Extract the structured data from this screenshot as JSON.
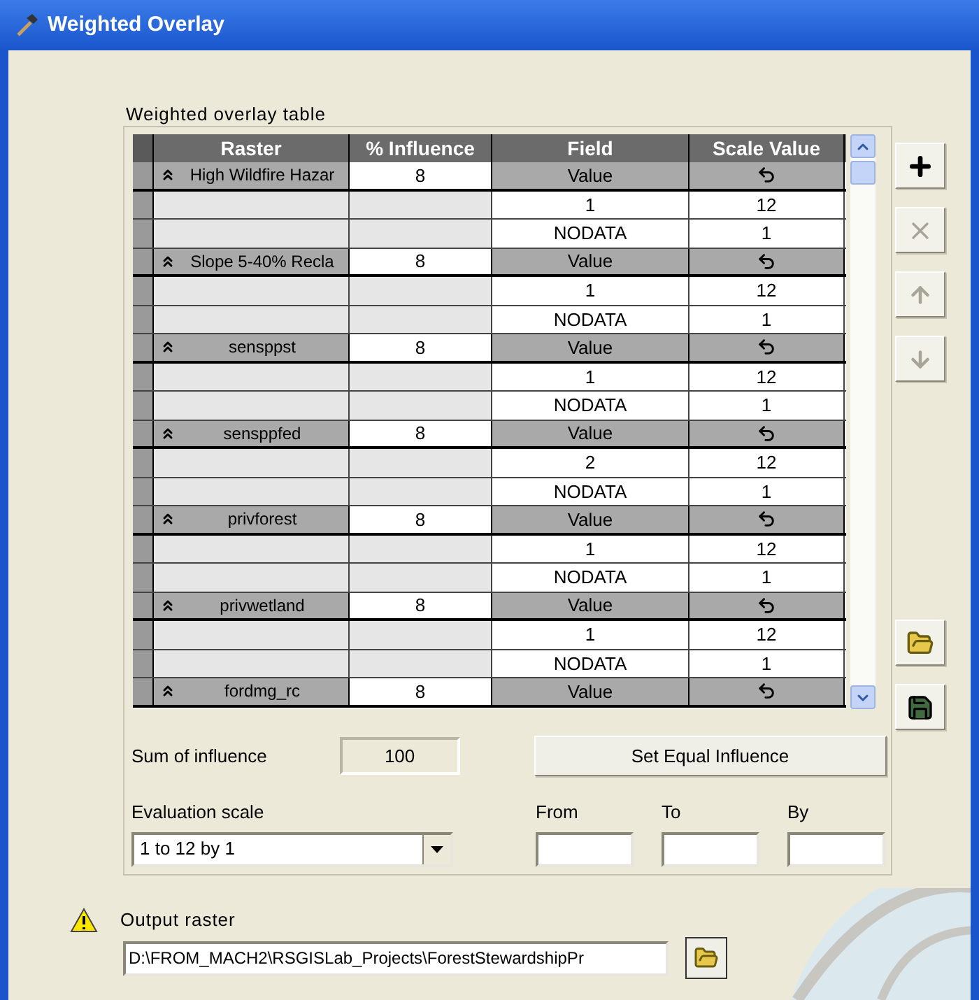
{
  "window": {
    "title": "Weighted Overlay"
  },
  "table": {
    "label": "Weighted overlay table",
    "columns": [
      "Raster",
      "% Influence",
      "Field",
      "Scale Value"
    ],
    "groups": [
      {
        "raster": "High Wildfire Hazar",
        "influence": "8",
        "field": "Value",
        "rows": [
          {
            "field": "1",
            "scale": "12"
          },
          {
            "field": "NODATA",
            "scale": "1"
          }
        ]
      },
      {
        "raster": "Slope 5-40% Recla",
        "influence": "8",
        "field": "Value",
        "rows": [
          {
            "field": "1",
            "scale": "12"
          },
          {
            "field": "NODATA",
            "scale": "1"
          }
        ]
      },
      {
        "raster": "sensppst",
        "influence": "8",
        "field": "Value",
        "rows": [
          {
            "field": "1",
            "scale": "12"
          },
          {
            "field": "NODATA",
            "scale": "1"
          }
        ]
      },
      {
        "raster": "sensppfed",
        "influence": "8",
        "field": "Value",
        "rows": [
          {
            "field": "2",
            "scale": "12"
          },
          {
            "field": "NODATA",
            "scale": "1"
          }
        ]
      },
      {
        "raster": "privforest",
        "influence": "8",
        "field": "Value",
        "rows": [
          {
            "field": "1",
            "scale": "12"
          },
          {
            "field": "NODATA",
            "scale": "1"
          }
        ]
      },
      {
        "raster": "privwetland",
        "influence": "8",
        "field": "Value",
        "rows": [
          {
            "field": "1",
            "scale": "12"
          },
          {
            "field": "NODATA",
            "scale": "1"
          }
        ]
      },
      {
        "raster": "fordmg_rc",
        "influence": "8",
        "field": "Value"
      }
    ]
  },
  "side_buttons": [
    {
      "kind": "add",
      "disabled": false
    },
    {
      "kind": "remove",
      "disabled": true
    },
    {
      "kind": "up",
      "disabled": true
    },
    {
      "kind": "down",
      "disabled": true
    },
    {
      "kind": "open",
      "disabled": false
    },
    {
      "kind": "save",
      "disabled": false
    }
  ],
  "sum_of_influence": {
    "label": "Sum of influence",
    "value": "100"
  },
  "set_equal_button": "Set Equal Influence",
  "evaluation_scale": {
    "label": "Evaluation scale",
    "value": "1 to 12 by 1"
  },
  "range_fields": [
    {
      "label": "From"
    },
    {
      "label": "To"
    },
    {
      "label": "By"
    }
  ],
  "output_raster": {
    "label": "Output raster",
    "value": "D:\\FROM_MACH2\\RSGISLab_Projects\\ForestStewardshipPr"
  }
}
